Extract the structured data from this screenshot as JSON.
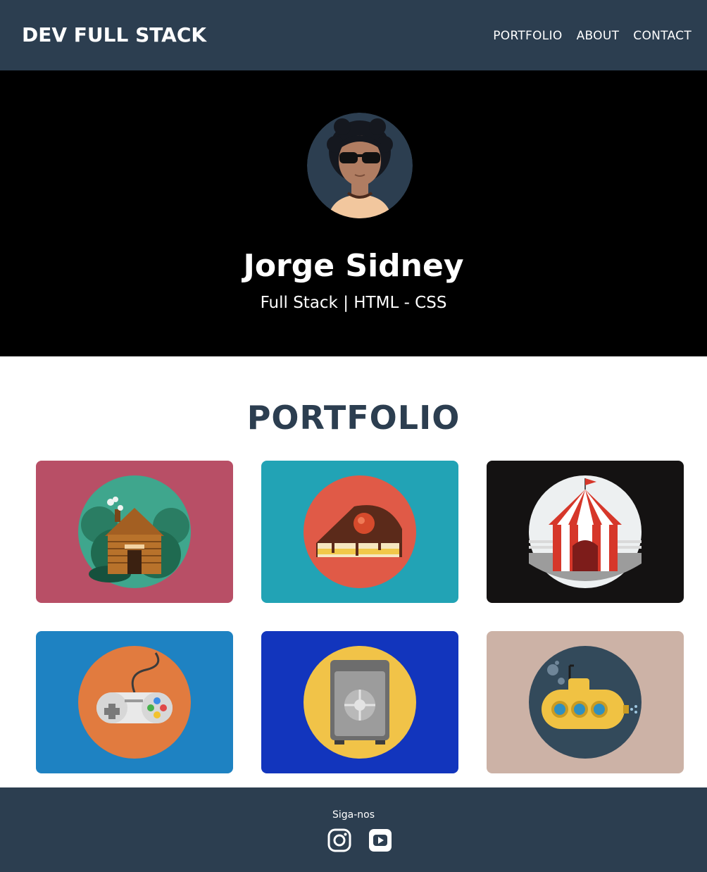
{
  "navbar": {
    "brand": "DEV FULL STACK",
    "links": [
      {
        "label": "PORTFOLIO"
      },
      {
        "label": "ABOUT"
      },
      {
        "label": "CONTACT"
      }
    ],
    "background": "#2c3e50"
  },
  "hero": {
    "name": "Jorge Sidney",
    "subtitle": "Full Stack | HTML - CSS",
    "avatar_icon": "avatar-sunglasses-icon"
  },
  "portfolio": {
    "title": "PORTFOLIO",
    "items": [
      {
        "icon": "log-cabin-icon",
        "background": "#b84f66"
      },
      {
        "icon": "cake-slice-icon",
        "background": "#22a3b5"
      },
      {
        "icon": "circus-tent-icon",
        "background": "#141212"
      },
      {
        "icon": "game-controller-icon",
        "background": "#1e82c2"
      },
      {
        "icon": "safe-icon",
        "background": "#1235bd"
      },
      {
        "icon": "submarine-icon",
        "background": "#ccb2a6"
      }
    ]
  },
  "footer": {
    "label": "Siga-nos",
    "social": [
      {
        "icon": "instagram-icon"
      },
      {
        "icon": "youtube-icon"
      }
    ]
  }
}
